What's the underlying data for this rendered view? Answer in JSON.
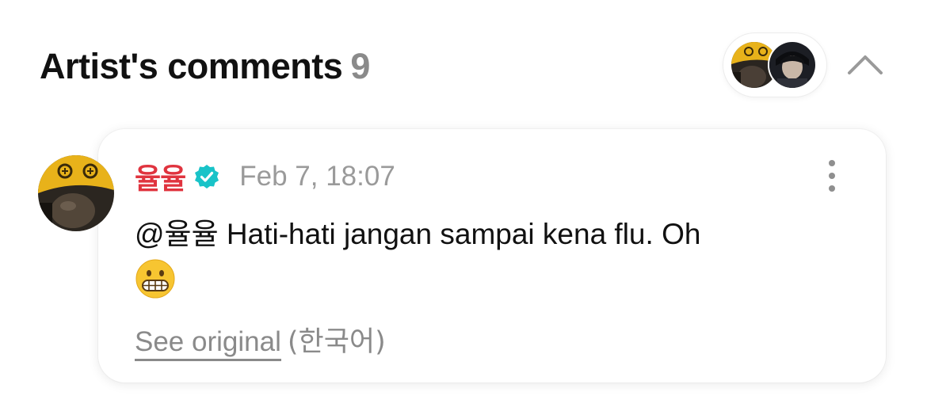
{
  "header": {
    "title": "Artist's comments",
    "count": "9"
  },
  "comment": {
    "author": "율율",
    "date": "Feb 7, 18:07",
    "mention": "@율율",
    "text": " Hati-hati jangan sampai kena flu. Oh",
    "emoji": "grimacing-face-emoji",
    "see_original_label": "See original",
    "language": "(한국어)"
  },
  "icons": {
    "collapse": "chevron-up-icon",
    "verified": "verified-badge-icon",
    "more": "more-vertical-icon"
  },
  "colors": {
    "author": "#e0343f",
    "verified": "#19c3c8",
    "muted": "#8a8a8a",
    "text": "#111111",
    "avatar_hat": "#e8b21a"
  }
}
